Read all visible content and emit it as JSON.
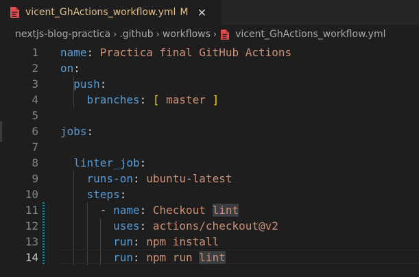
{
  "tab": {
    "file_icon": "yaml-file-icon",
    "label": "vicent_GhActions_workflow.yml",
    "modified": "M",
    "close": "✕"
  },
  "breadcrumb": {
    "items": [
      "nextjs-blog-practica",
      ".github",
      "workflows",
      "vicent_GhActions_workflow.yml"
    ],
    "separator": "›"
  },
  "editor": {
    "active_line": 14,
    "lines": [
      {
        "n": "1",
        "parts": [
          {
            "t": "name",
            "c": "k"
          },
          {
            "t": ": ",
            "c": "p"
          },
          {
            "t": "Practica final GitHub Actions",
            "c": "v"
          }
        ]
      },
      {
        "n": "2",
        "parts": [
          {
            "t": "on",
            "c": "k"
          },
          {
            "t": ":",
            "c": "p"
          }
        ]
      },
      {
        "n": "3",
        "parts": [
          {
            "t": "  ",
            "c": "p"
          },
          {
            "t": "push",
            "c": "k"
          },
          {
            "t": ":",
            "c": "p"
          }
        ]
      },
      {
        "n": "4",
        "parts": [
          {
            "t": "    ",
            "c": "p"
          },
          {
            "t": "branches",
            "c": "k"
          },
          {
            "t": ": ",
            "c": "p"
          },
          {
            "t": "[",
            "c": "br"
          },
          {
            "t": " master ",
            "c": "v"
          },
          {
            "t": "]",
            "c": "br"
          }
        ]
      },
      {
        "n": "5",
        "parts": []
      },
      {
        "n": "6",
        "parts": [
          {
            "t": "jobs",
            "c": "k"
          },
          {
            "t": ":",
            "c": "p"
          }
        ]
      },
      {
        "n": "7",
        "parts": []
      },
      {
        "n": "8",
        "parts": [
          {
            "t": "  ",
            "c": "p"
          },
          {
            "t": "linter_job",
            "c": "k"
          },
          {
            "t": ":",
            "c": "p"
          }
        ]
      },
      {
        "n": "9",
        "parts": [
          {
            "t": "    ",
            "c": "p"
          },
          {
            "t": "runs-on",
            "c": "k"
          },
          {
            "t": ": ",
            "c": "p"
          },
          {
            "t": "ubuntu-latest",
            "c": "v"
          }
        ]
      },
      {
        "n": "10",
        "parts": [
          {
            "t": "    ",
            "c": "p"
          },
          {
            "t": "steps",
            "c": "k"
          },
          {
            "t": ":",
            "c": "p"
          }
        ]
      },
      {
        "n": "11",
        "parts": [
          {
            "t": "      ",
            "c": "p"
          },
          {
            "t": "- ",
            "c": "p"
          },
          {
            "t": "name",
            "c": "k"
          },
          {
            "t": ": ",
            "c": "p"
          },
          {
            "t": "Checkout ",
            "c": "v"
          },
          {
            "t": "lint",
            "c": "v hl"
          }
        ]
      },
      {
        "n": "12",
        "parts": [
          {
            "t": "        ",
            "c": "p"
          },
          {
            "t": "uses",
            "c": "k"
          },
          {
            "t": ": ",
            "c": "p"
          },
          {
            "t": "actions/checkout@v2",
            "c": "v"
          }
        ]
      },
      {
        "n": "13",
        "parts": [
          {
            "t": "        ",
            "c": "p"
          },
          {
            "t": "run",
            "c": "k"
          },
          {
            "t": ": ",
            "c": "p"
          },
          {
            "t": "npm install",
            "c": "v"
          }
        ]
      },
      {
        "n": "14",
        "parts": [
          {
            "t": "        ",
            "c": "p"
          },
          {
            "t": "run",
            "c": "k"
          },
          {
            "t": ": ",
            "c": "p"
          },
          {
            "t": "npm run ",
            "c": "v"
          },
          {
            "t": "lint",
            "c": "v hl"
          }
        ]
      }
    ]
  },
  "colors": {
    "background": "#1e1e1e",
    "tab_label_modified": "#e2c08d",
    "key": "#569cd6",
    "string": "#ce9178",
    "bracket": "#ffd700",
    "change_bar": "#1b81a8"
  }
}
